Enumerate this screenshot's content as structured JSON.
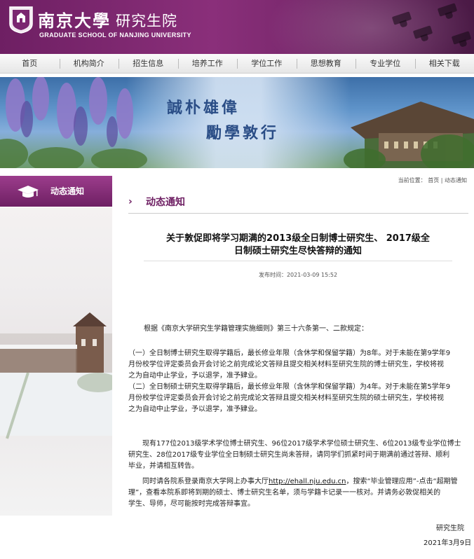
{
  "header": {
    "school_cn": "南京大學",
    "school_cn2": "研究生院",
    "school_en": "GRADUATE SCHOOL OF NANJING UNIVERSITY"
  },
  "nav": {
    "items": [
      "首页",
      "机构简介",
      "招生信息",
      "培养工作",
      "学位工作",
      "思想教育",
      "专业学位",
      "相关下载"
    ]
  },
  "banner": {
    "slogan_line1": "誠朴雄偉",
    "slogan_line2": "勵學敦行"
  },
  "sidebar": {
    "title": "动态通知"
  },
  "breadcrumb": {
    "label": "当前位置：",
    "home": "首页",
    "sep": "|",
    "current": "动态通知"
  },
  "section": {
    "title": "动态通知"
  },
  "article": {
    "title_line1": "关于敦促即将学习期满的2013级全日制博士研究生、 2017级全",
    "title_line2": "日制硕士研究生尽快答辩的通知",
    "publish_time": "发布时间：2021-03-09 15:52",
    "p1": "根据《南京大学研究生学籍管理实施细则》第三十六条第一、二款规定：",
    "p2_line1": "（一）全日制博士研究生取得学籍后，最长修业年限（含休学和保留学籍）为8年。对于未能在第9学年9",
    "p2_line2": "月份校学位评定委员会开会讨论之前完成论文答辩且提交相关材料至研究生院的博士研究生，学校将视",
    "p2_line3": "之为自动中止学业，予以退学，准予肄业。",
    "p3_line1": "（二）全日制硕士研究生取得学籍后，最长修业年限（含休学和保留学籍）为4年。对于未能在第5学年9",
    "p3_line2": "月份校学位评定委员会开会讨论之前完成论文答辩且提交相关材料至研究生院的硕士研究生，学校将视",
    "p3_line3": "之为自动中止学业，予以退学，准予肄业。",
    "p4_line1": "现有177位2013级学术学位博士研究生、96位2017级学术学位硕士研究生、6位2013级专业学位博士",
    "p4_line2": "研究生、28位2017级专业学位全日制硕士研究生尚未答辩，请同学们抓紧时间于期满前通过答辩、顺利",
    "p4_line3": "毕业，并请相互转告。",
    "p5_pre": "同时请各院系登录南京大学网上办事大厅",
    "p5_link": "http://ehall.nju.edu.cn",
    "p5_post": "，搜索“毕业管理应用”-点击“超期管",
    "p5_line2": "理”，查看本院系即将到期的硕士、博士研究生名单，须与学籍卡记录一一核对。并请务必敦促相关的",
    "p5_line3": "学生、导师，尽可能按时完成答辩事宜。",
    "signature": "研究生院",
    "date": "2021年3月9日"
  }
}
